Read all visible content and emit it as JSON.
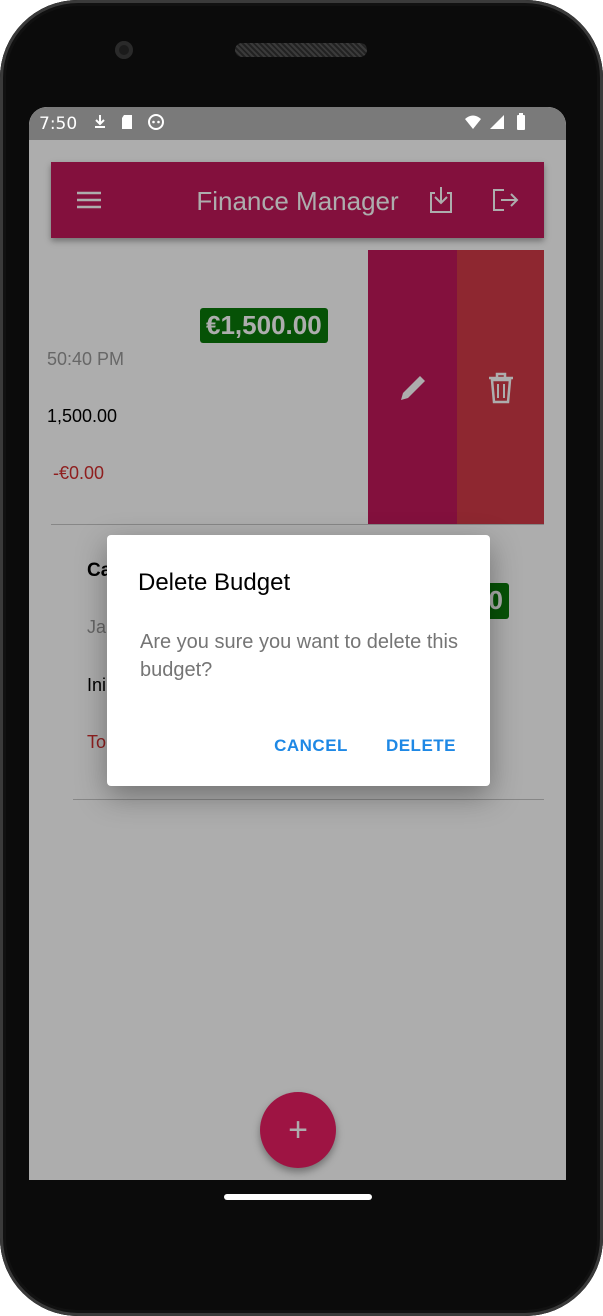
{
  "status_bar": {
    "time": "7:50",
    "left_icons": [
      "download-notification-icon",
      "sd-card-icon",
      "android-icon"
    ],
    "right_icons": [
      "wifi-icon",
      "signal-icon",
      "battery-icon"
    ]
  },
  "app_bar": {
    "title": "Finance Manager",
    "menu_icon": "menu-icon",
    "actions": [
      "download-icon",
      "logout-icon"
    ],
    "color": "#c2185b"
  },
  "budget_cards": [
    {
      "amount": "€1,500.00",
      "time": "50:40 PM",
      "initial": "1,500.00",
      "total": "-€0.00",
      "swipe_actions": [
        "edit-icon",
        "delete-icon"
      ]
    },
    {
      "title": "Ca",
      "date": "Ja",
      "initial": "Ini",
      "total": "To",
      "amount": "0"
    }
  ],
  "fab": {
    "icon": "plus-icon",
    "label": "+"
  },
  "dialog": {
    "title": "Delete Budget",
    "message": "Are you sure you want to delete this budget?",
    "cancel_label": "CANCEL",
    "delete_label": "DELETE"
  },
  "colors": {
    "primary": "#c2185b",
    "accent": "#e91e63",
    "delete_swipe": "#d23a47",
    "positive_badge": "#0a7a0a",
    "negative_text": "#d32f2f",
    "dialog_action": "#1e88e5"
  }
}
